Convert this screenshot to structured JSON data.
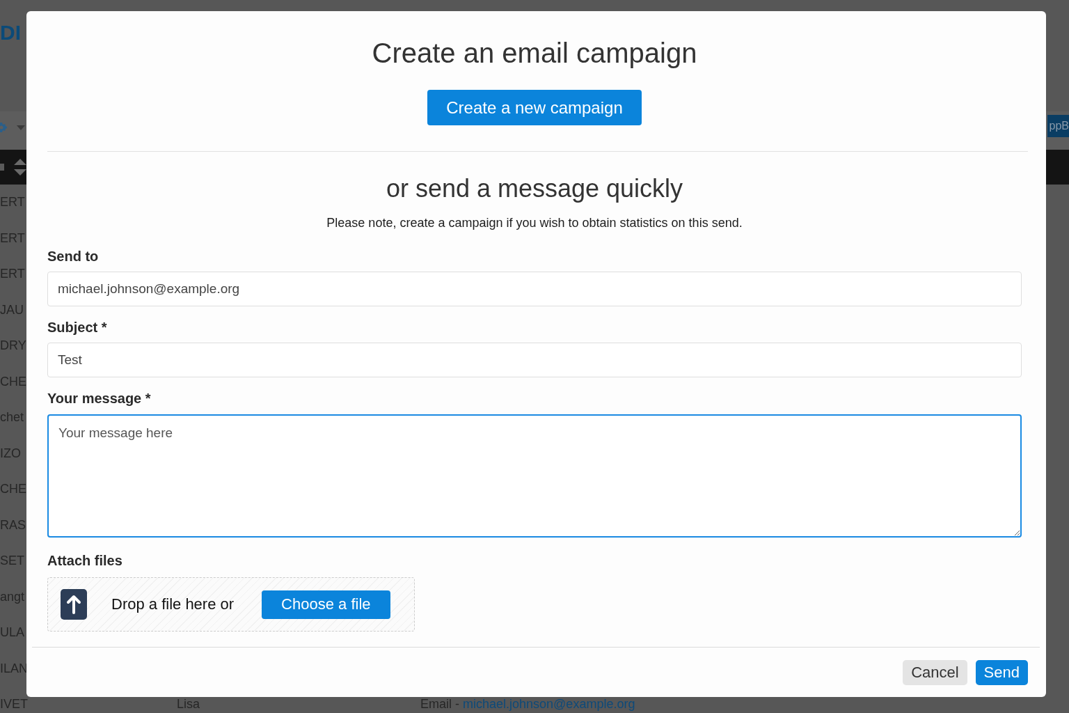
{
  "background": {
    "logo": "DI",
    "toolbar_button": "ppB",
    "rows": [
      {
        "column_1": "ERT"
      },
      {
        "column_1": "ERT"
      },
      {
        "column_1": "ERT"
      },
      {
        "column_1": "JAU"
      },
      {
        "column_1": "DRY"
      },
      {
        "column_1": "CHE"
      },
      {
        "column_1": "chet"
      },
      {
        "column_1": "IZO"
      },
      {
        "column_1": "CHE"
      },
      {
        "column_1": "RAS"
      },
      {
        "column_1": "SET"
      },
      {
        "column_1": "angt"
      },
      {
        "column_1": "ULA"
      },
      {
        "column_1": "ILAN"
      },
      {
        "column_1": "IVET",
        "column_2": "Lisa",
        "column_3": "Email -",
        "column_3_link": "michael.johnson@example.org"
      }
    ]
  },
  "dialog": {
    "title": "Create an email campaign",
    "campaign_button": "Create a new campaign",
    "subtitle": "or send a message quickly",
    "note": "Please note, create a campaign if you wish to obtain statistics on this send.",
    "fields": [
      {
        "kind": "input",
        "label": "Send to",
        "value": "michael.johnson@example.org",
        "focused": false
      },
      {
        "kind": "input",
        "label": "Subject *",
        "value": "Test",
        "focused": false
      },
      {
        "kind": "textarea",
        "label": "Your message *",
        "placeholder": "Your message here",
        "focused": true
      }
    ],
    "attachments": {
      "label": "Attach files",
      "drop_text": "Drop a file here or",
      "button": "Choose a file"
    },
    "buttons": [
      {
        "label": "Cancel",
        "kind": "secondary"
      },
      {
        "label": "Send",
        "kind": "primary"
      }
    ]
  }
}
